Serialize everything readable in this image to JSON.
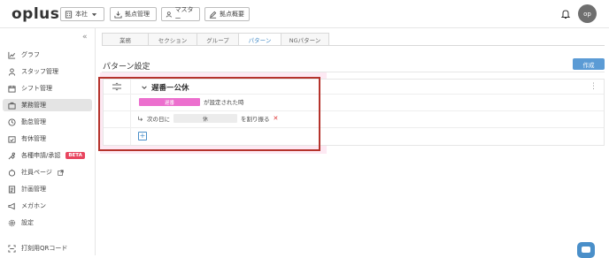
{
  "app": {
    "logo": "oplus"
  },
  "header": {
    "org_select": "本社",
    "btn_site_manage": "拠点管理",
    "btn_master": "マスター",
    "btn_site_overview": "拠点概要",
    "avatar": "op"
  },
  "sidebar": {
    "items": [
      {
        "label": "グラフ",
        "icon": "chart-icon"
      },
      {
        "label": "スタッフ管理",
        "icon": "person-icon"
      },
      {
        "label": "シフト管理",
        "icon": "calendar-icon"
      },
      {
        "label": "業務管理",
        "icon": "work-icon"
      },
      {
        "label": "勤怠管理",
        "icon": "clock-icon"
      },
      {
        "label": "有休管理",
        "icon": "calendar-check-icon"
      },
      {
        "label": "各種申請/承認",
        "icon": "approval-icon",
        "badge": "BETA"
      },
      {
        "label": "社員ページ",
        "icon": "employee-page-icon"
      },
      {
        "label": "計画管理",
        "icon": "plan-icon"
      },
      {
        "label": "メガホン",
        "icon": "megaphone-icon"
      },
      {
        "label": "設定",
        "icon": "gear-icon"
      },
      {
        "label": "打刻用QRコード",
        "icon": "qr-icon"
      }
    ]
  },
  "tabs": [
    "業務",
    "セクション",
    "グループ",
    "パターン",
    "NGパターン"
  ],
  "active_tab": "パターン",
  "page": {
    "title": "パターン設定",
    "create_button": "作成"
  },
  "pattern": {
    "name": "遅番ー公休",
    "condition_badge": "遅番",
    "condition_text": "が設定された時",
    "action_prefix": "次の日に",
    "action_value": "休",
    "action_suffix": "を割り振る"
  },
  "colors": {
    "accent": "#5b9bd5",
    "badge": "#ec6fce",
    "beta": "#e8455f",
    "highlight": "#b5332c"
  }
}
